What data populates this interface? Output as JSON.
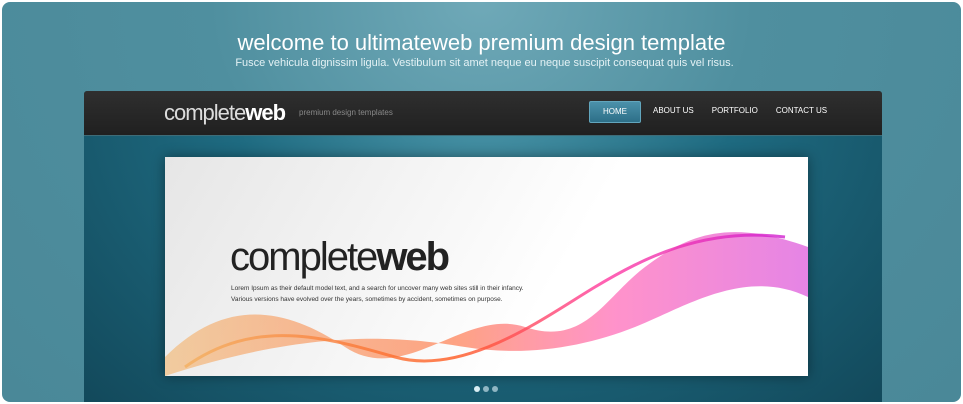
{
  "header": {
    "title": "welcome to ultimateweb premium design template",
    "subtitle": "Fusce vehicula dignissim ligula. Vestibulum sit amet neque eu neque suscipit consequat quis vel risus."
  },
  "site": {
    "logo_light": "complete",
    "logo_bold": "web",
    "tagline": "premium design templates",
    "nav": [
      {
        "label": "HOME",
        "active": true
      },
      {
        "label": "ABOUT US"
      },
      {
        "label": "PORTFOLIO"
      },
      {
        "label": "CONTACT US"
      }
    ]
  },
  "slide": {
    "logo_light": "complete",
    "logo_bold": "web",
    "line1": "Lorem Ipsum as their default model text, and a search for uncover many web sites still in their infancy.",
    "line2": "Various versions have evolved over the years, sometimes by accident, sometimes on purpose.",
    "active_dot": 1,
    "dot_count": 3
  },
  "colors": {
    "background": "#4f8f9f",
    "nav_active": "#3c84a0"
  }
}
